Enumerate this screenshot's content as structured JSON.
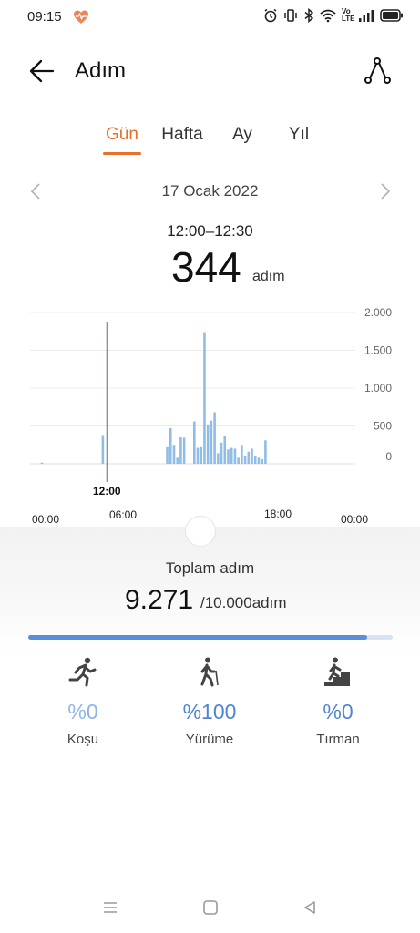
{
  "status_bar": {
    "time": "09:15",
    "icons": [
      "heart-rate-icon",
      "alarm-icon",
      "vibrate-icon",
      "bluetooth-icon",
      "wifi-icon",
      "volte-icon",
      "signal-icon",
      "battery-icon"
    ],
    "volte_text": "Vo LTE"
  },
  "header": {
    "title": "Adım",
    "back_icon": "arrow-left-icon",
    "route_icon": "route-icon"
  },
  "tabs": [
    {
      "label": "Gün",
      "active": true
    },
    {
      "label": "Hafta",
      "active": false
    },
    {
      "label": "Ay",
      "active": false
    },
    {
      "label": "Yıl",
      "active": false
    }
  ],
  "date_nav": {
    "date": "17 Ocak 2022"
  },
  "selection": {
    "time_range": "12:00–12:30",
    "steps": "344",
    "unit": "adım"
  },
  "chart_data": {
    "type": "bar",
    "y_ticks": [
      "2.000",
      "1.500",
      "1.000",
      "500",
      "0"
    ],
    "ylim": [
      0,
      2000
    ],
    "grid": true,
    "x_ticks": [
      "00:00",
      "06:00",
      "12:00",
      "18:00",
      "00:00"
    ],
    "selected_label": "12:00",
    "selected_bin": 24,
    "values": [
      0,
      0,
      0,
      15,
      0,
      0,
      0,
      0,
      0,
      0,
      0,
      0,
      0,
      0,
      0,
      0,
      0,
      0,
      0,
      0,
      0,
      380,
      0,
      0,
      0,
      0,
      0,
      0,
      0,
      0,
      0,
      0,
      0,
      0,
      0,
      0,
      0,
      0,
      0,
      0,
      220,
      470,
      250,
      80,
      350,
      344,
      0,
      0,
      560,
      210,
      220,
      1740,
      520,
      570,
      680,
      140,
      280,
      370,
      190,
      210,
      200,
      80,
      250,
      110,
      160,
      200,
      100,
      80,
      60,
      310,
      0,
      0,
      0,
      0,
      0,
      0,
      0,
      0,
      0,
      0,
      0,
      0,
      0,
      0,
      0,
      0,
      0,
      0,
      0,
      0,
      0,
      0,
      0,
      0,
      0,
      0
    ]
  },
  "summary": {
    "total_label": "Toplam adım",
    "total_value": "9.271",
    "goal_text": "/10.000adım",
    "progress": 0.93
  },
  "activities": [
    {
      "icon": "running-icon",
      "percent": "%0",
      "label": "Koşu"
    },
    {
      "icon": "walking-icon",
      "percent": "%100",
      "label": "Yürüme"
    },
    {
      "icon": "climbing-icon",
      "percent": "%0",
      "label": "Tırman"
    }
  ],
  "colors": {
    "accent": "#e8702a",
    "bar": "#8fbde8",
    "bar_selected": "#2f6fb3",
    "progress": "#5b8ed8"
  },
  "nav_bar": [
    "menu-icon",
    "home-icon",
    "back-triangle-icon"
  ]
}
